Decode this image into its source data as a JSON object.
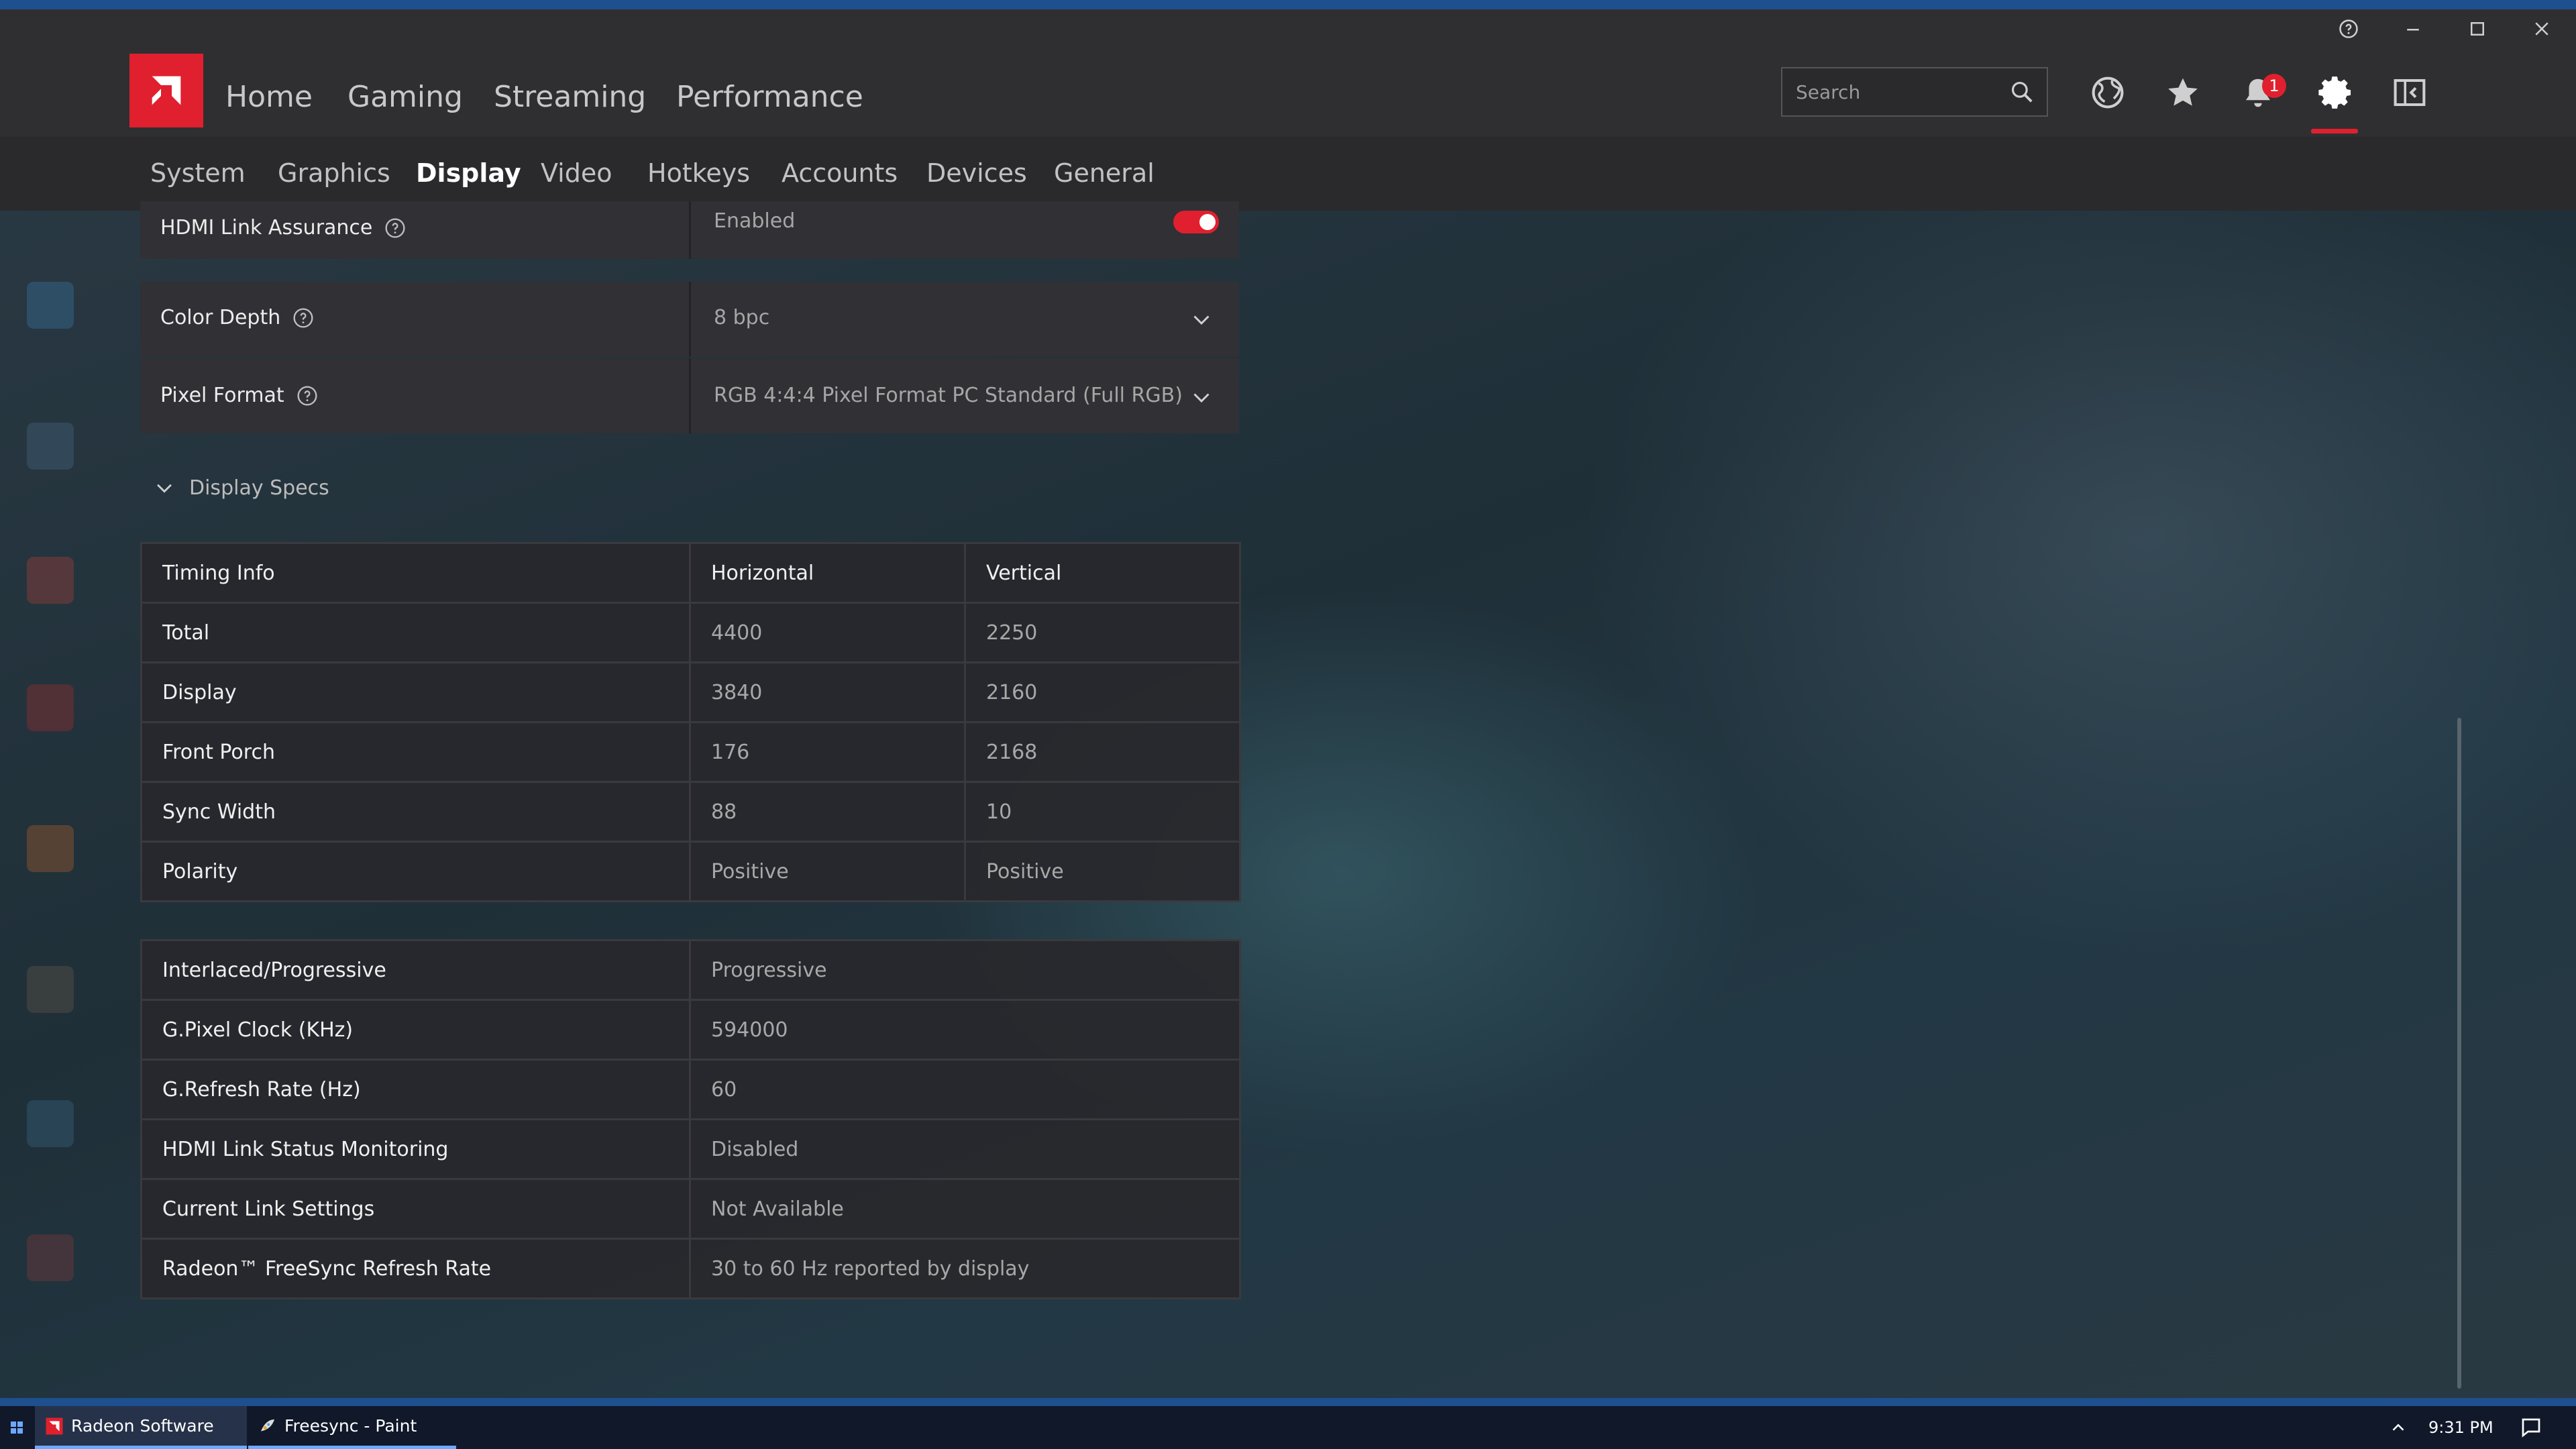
{
  "app": {
    "top_tabs": [
      "Home",
      "Gaming",
      "Streaming",
      "Performance"
    ],
    "search_placeholder": "Search",
    "notification_count": "1",
    "sub_tabs": [
      "System",
      "Graphics",
      "Display",
      "Video",
      "Hotkeys",
      "Accounts",
      "Devices",
      "General"
    ],
    "active_sub_tab": "Display",
    "accent_color": "#e0202e"
  },
  "settings": {
    "hdmi_link_assurance": {
      "label": "HDMI Link Assurance",
      "value": "Enabled",
      "toggle_on": true
    },
    "color_depth": {
      "label": "Color Depth",
      "value": "8 bpc"
    },
    "pixel_format": {
      "label": "Pixel Format",
      "value": "RGB 4:4:4 Pixel Format PC Standard (Full RGB)"
    }
  },
  "display_specs": {
    "title": "Display Specs",
    "timing_headers": [
      "Timing Info",
      "Horizontal",
      "Vertical"
    ],
    "timing_rows": [
      {
        "label": "Total",
        "h": "4400",
        "v": "2250"
      },
      {
        "label": "Display",
        "h": "3840",
        "v": "2160"
      },
      {
        "label": "Front Porch",
        "h": "176",
        "v": "2168"
      },
      {
        "label": "Sync Width",
        "h": "88",
        "v": "10"
      },
      {
        "label": "Polarity",
        "h": "Positive",
        "v": "Positive"
      }
    ],
    "info_rows": [
      {
        "label": "Interlaced/Progressive",
        "value": "Progressive"
      },
      {
        "label": "G.Pixel Clock (KHz)",
        "value": "594000"
      },
      {
        "label": "G.Refresh Rate (Hz)",
        "value": "60"
      },
      {
        "label": "HDMI Link Status Monitoring",
        "value": "Disabled"
      },
      {
        "label": "Current Link Settings",
        "value": "Not Available"
      },
      {
        "label": "Radeon™ FreeSync Refresh Rate",
        "value": "30 to 60 Hz reported by display"
      }
    ]
  },
  "taskbar": {
    "items": [
      "Radeon Software",
      "Freesync - Paint"
    ],
    "time": "9:31 PM"
  },
  "icons": {
    "nav": [
      "globe-icon",
      "star-icon",
      "bell-icon",
      "gear-icon",
      "sidebar-toggle-icon"
    ],
    "window": [
      "help-icon",
      "minimize-icon",
      "maximize-icon",
      "close-icon"
    ]
  }
}
